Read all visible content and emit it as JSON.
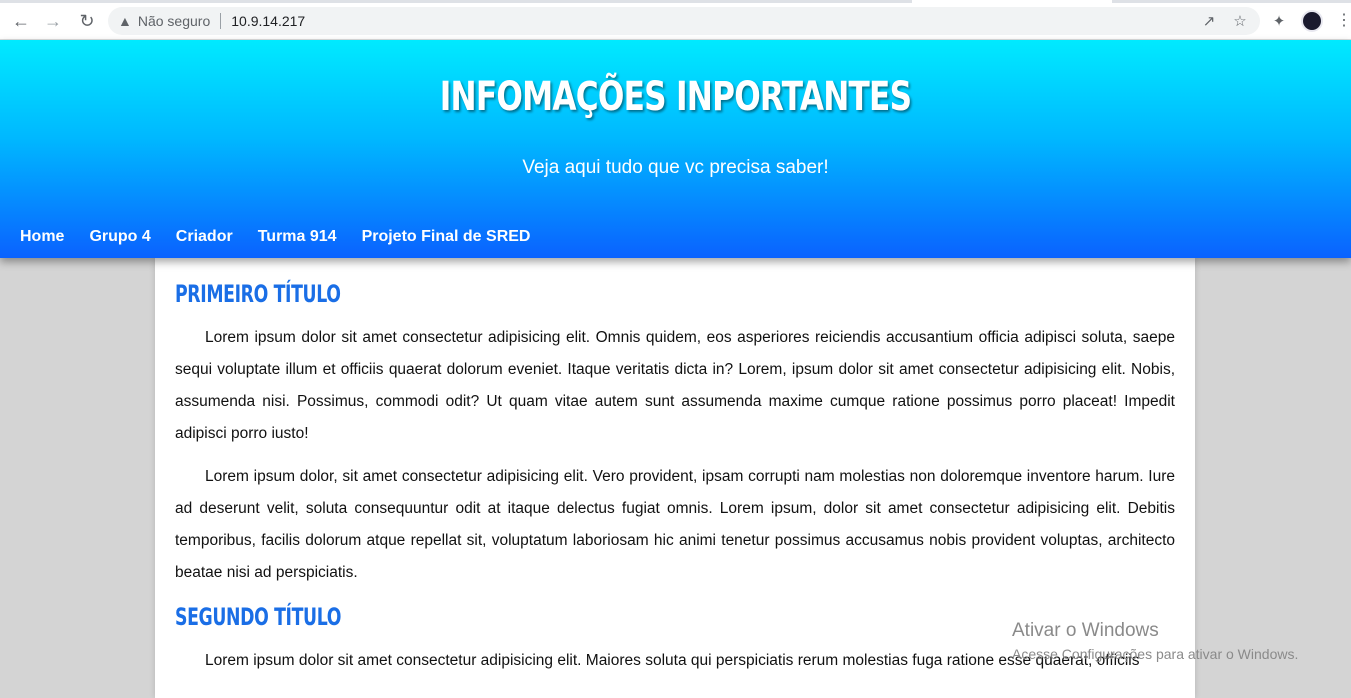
{
  "browser": {
    "security_label": "Não seguro",
    "url": "10.9.14.217"
  },
  "header": {
    "title": "INFOMAÇÕES INPORTANTES",
    "subtitle": "Veja aqui tudo que vc precisa saber!",
    "nav": [
      {
        "label": "Home"
      },
      {
        "label": "Grupo 4"
      },
      {
        "label": "Criador"
      },
      {
        "label": "Turma 914"
      },
      {
        "label": "Projeto Final de SRED"
      }
    ]
  },
  "sections": [
    {
      "title": "PRIMEIRO TÍTULO",
      "paragraphs": [
        "Lorem ipsum dolor sit amet consectetur adipisicing elit. Omnis quidem, eos asperiores reiciendis accusantium officia adipisci soluta, saepe sequi voluptate illum et officiis quaerat dolorum eveniet. Itaque veritatis dicta in? Lorem, ipsum dolor sit amet consectetur adipisicing elit. Nobis, assumenda nisi. Possimus, commodi odit? Ut quam vitae autem sunt assumenda maxime cumque ratione possimus porro placeat! Impedit adipisci porro iusto!",
        "Lorem ipsum dolor, sit amet consectetur adipisicing elit. Vero provident, ipsam corrupti nam molestias non doloremque inventore harum. Iure ad deserunt velit, soluta consequuntur odit at itaque delectus fugiat omnis. Lorem ipsum, dolor sit amet consectetur adipisicing elit. Debitis temporibus, facilis dolorum atque repellat sit, voluptatum laboriosam hic animi tenetur possimus accusamus nobis provident voluptas, architecto beatae nisi ad perspiciatis."
      ]
    },
    {
      "title": "SEGUNDO TÍTULO",
      "paragraphs": [
        "Lorem ipsum dolor sit amet consectetur adipisicing elit. Maiores soluta qui perspiciatis rerum molestias fuga ratione esse quaerat, officiis"
      ]
    }
  ],
  "watermark": {
    "line1": "Ativar o Windows",
    "line2": "Acesse Configurações para ativar o Windows."
  },
  "colors": {
    "header_top": "#00eaff",
    "header_bottom": "#0a62ff",
    "section_title": "#1a6ee6",
    "page_background": "#d4d4d4"
  },
  "icons": [
    "back-arrow-icon",
    "forward-arrow-icon",
    "reload-icon",
    "warning-icon",
    "share-icon",
    "star-icon",
    "extensions-icon",
    "profile-avatar-icon",
    "menu-kebab-icon"
  ]
}
